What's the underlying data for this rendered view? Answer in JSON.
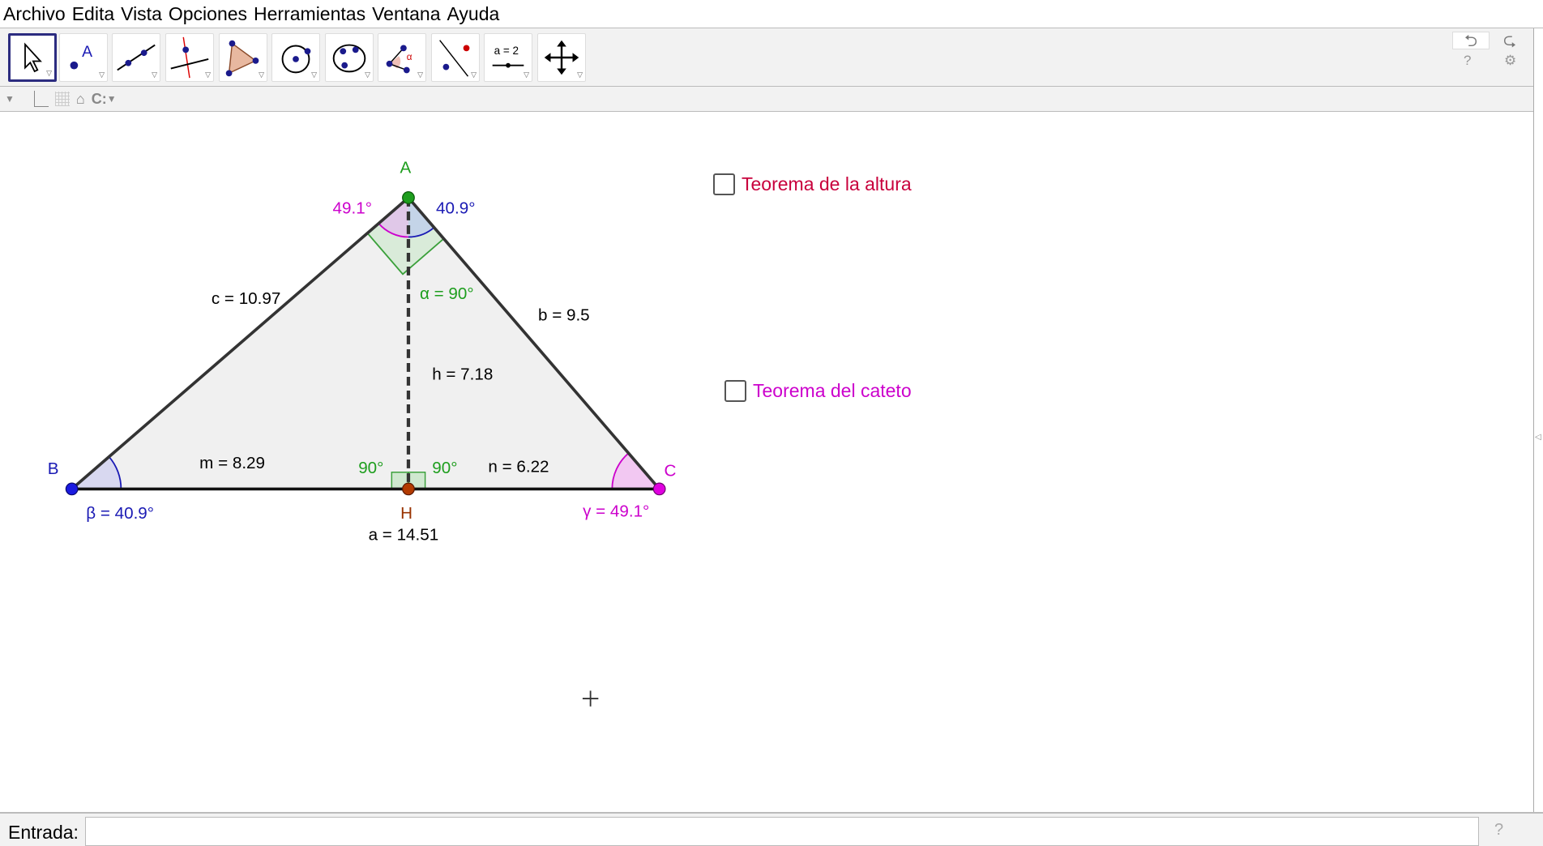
{
  "menu": [
    "Archivo",
    "Edita",
    "Vista",
    "Opciones",
    "Herramientas",
    "Ventana",
    "Ayuda"
  ],
  "toolbar": {
    "tools": [
      "move-tool",
      "point-tool",
      "line-tool",
      "perpendicular-tool",
      "polygon-tool",
      "circle-tool",
      "conic-tool",
      "angle-tool",
      "reflect-tool",
      "slider-tool",
      "move-view-tool"
    ],
    "slider_label": "a = 2",
    "point_label": "A",
    "angle_label": "α",
    "undo": "⮌",
    "redo": "⮎",
    "help": "?",
    "settings": "⚙"
  },
  "stylebar": {
    "home": "⌂",
    "label_style": "C:"
  },
  "construction": {
    "points": {
      "A": "A",
      "B": "B",
      "C": "C",
      "H": "H"
    },
    "sides": {
      "a": "a = 14.51",
      "b": "b = 9.5",
      "c": "c = 10.97",
      "h": "h = 7.18",
      "m": "m = 8.29",
      "n": "n = 6.22"
    },
    "angles": {
      "alpha": "α = 90°",
      "beta": "β = 40.9°",
      "gamma": "γ = 49.1°",
      "A_left": "49.1°",
      "A_right": "40.9°",
      "H_left": "90°",
      "H_right": "90°"
    }
  },
  "checkboxes": [
    {
      "label": "Teorema de la altura",
      "checked": false,
      "color": "#c8003c"
    },
    {
      "label": "Teorema del cateto",
      "checked": false,
      "color": "#cc00cc"
    }
  ],
  "colors": {
    "green": "#1e9e1e",
    "blue": "#1a1ab4",
    "magenta": "#cc00cc",
    "brown": "#993300"
  },
  "input": {
    "label": "Entrada:",
    "value": "",
    "help": "?"
  }
}
